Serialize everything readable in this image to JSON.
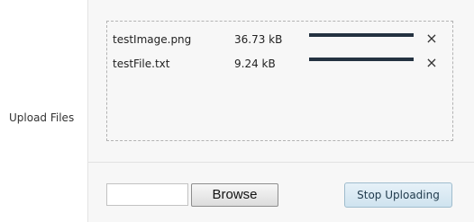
{
  "form": {
    "label": "Upload Files"
  },
  "upload_list": {
    "files": [
      {
        "name": "testImage.png",
        "size": "36.73 kB",
        "progress": 1.0,
        "remove_glyph": "×"
      },
      {
        "name": "testFile.txt",
        "size": "9.24 kB",
        "progress": 1.0,
        "remove_glyph": "×"
      }
    ]
  },
  "controls": {
    "file_input_value": "",
    "browse_label": "Browse",
    "stop_label": "Stop Uploading"
  },
  "colors": {
    "progress_fill": "#243241",
    "panel_background": "#f7f7f7",
    "stop_button": "#d8e9f3"
  },
  "icons": {
    "remove": "close-icon"
  }
}
